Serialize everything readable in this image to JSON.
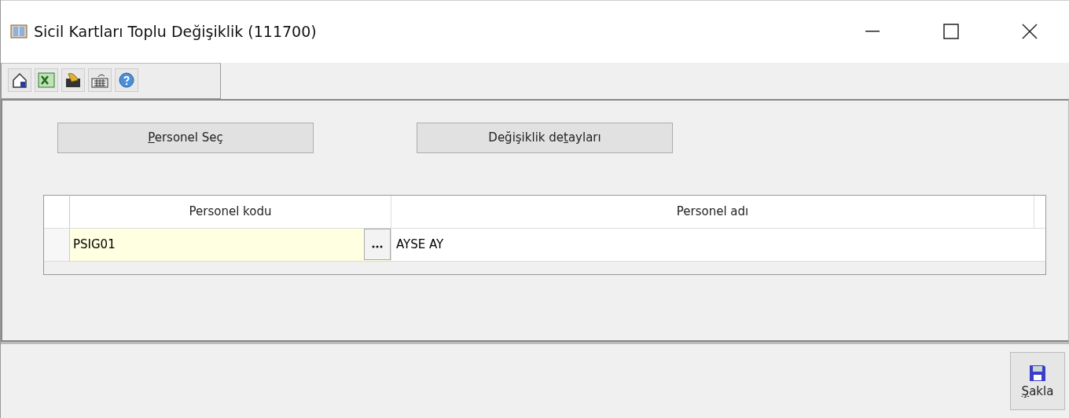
{
  "window": {
    "title": "Sicil Kartları Toplu Değişiklik (111700)"
  },
  "toolbar": {
    "tools": [
      {
        "kind": "home"
      },
      {
        "kind": "excel"
      },
      {
        "kind": "hand"
      },
      {
        "kind": "keyboard"
      },
      {
        "kind": "help"
      }
    ]
  },
  "buttons": [
    {
      "access_key": "P",
      "label_post": "ersonel Seç"
    },
    {
      "label_pre": "Değişiklik de",
      "access_key": "t",
      "label_post": "ayları"
    }
  ],
  "table": {
    "columns": [
      "Personel kodu",
      "Personel adı"
    ],
    "rows": [
      {
        "code": "PSIG01",
        "name": "AYSE AY"
      }
    ]
  },
  "footer": {
    "save_button": {
      "access_key": "Ş",
      "label_post": "akla"
    }
  }
}
